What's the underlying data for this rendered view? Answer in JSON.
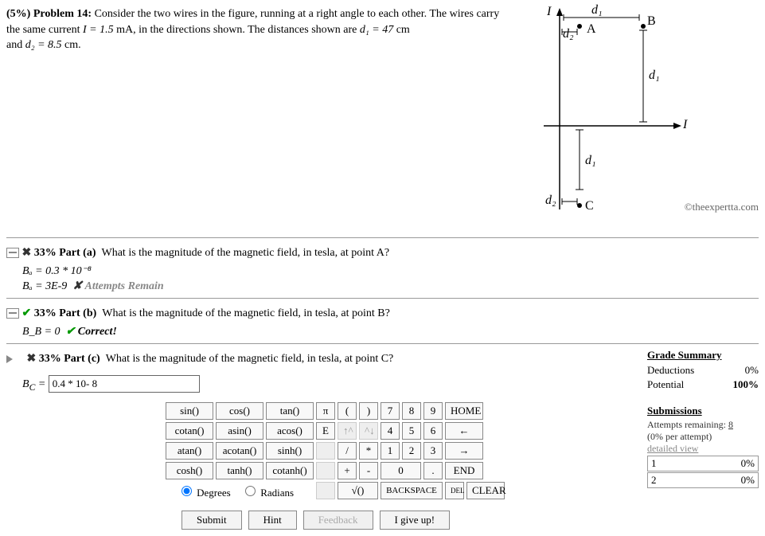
{
  "problem": {
    "label": "(5%) Problem 14:",
    "text1": "Consider the two wires in the figure, running at a right angle to each other. The wires carry the same current ",
    "ieq": "I = 1.5",
    "iunits": " mA, in the directions shown. The distances shown are ",
    "d1eq": "d₁ = 47",
    "d1units": " cm",
    "text2": "and ",
    "d2eq": "d₂ = 8.5",
    "d2units": " cm."
  },
  "figure": {
    "I": "I",
    "d1": "d₁",
    "d2": "d₂",
    "A": "A",
    "B": "B",
    "C": "C",
    "copyright": "©theexpertta.com"
  },
  "partA": {
    "pct": "33%",
    "label": "Part (a)",
    "question": "What is the magnitude of the magnetic field, in tesla, at point A?",
    "line1": "Bₐ = 0.3 * 10⁻⁸",
    "line2_prefix": "Bₐ = 3E-9",
    "line2_status": "✘ Attempts Remain"
  },
  "partB": {
    "pct": "33%",
    "label": "Part (b)",
    "question": "What is the magnitude of the magnetic field, in tesla, at point B?",
    "line1_prefix": "B_B = 0",
    "line1_status": "✔ Correct!"
  },
  "partC": {
    "pct": "33%",
    "label": "Part (c)",
    "question": "What is the magnitude of the magnetic field, in tesla, at point C?",
    "var": "B_C =",
    "value": "0.4 * 10- 8"
  },
  "keypad": {
    "r1": [
      "sin()",
      "cos()",
      "tan()"
    ],
    "r2": [
      "cotan()",
      "asin()",
      "acos()"
    ],
    "r3": [
      "atan()",
      "acotan()",
      "sinh()"
    ],
    "r4": [
      "cosh()",
      "tanh()",
      "cotanh()"
    ],
    "sym": {
      "pi": "π",
      "lp": "(",
      "rp": ")",
      "E": "E",
      "up": "↑^",
      "di": "^↓",
      "sl": "/",
      "st": "*",
      "pl": "+",
      "mn": "-",
      "sq": "√()",
      "home": "HOME",
      "bksp": "BACKSPACE",
      "del": "DEL",
      "clr": "CLEAR",
      "end": "END",
      "left": "←",
      "right": "→"
    },
    "nums": [
      "7",
      "8",
      "9",
      "4",
      "5",
      "6",
      "1",
      "2",
      "3",
      "0",
      "."
    ],
    "deg": "Degrees",
    "rad": "Radians"
  },
  "actions": {
    "submit": "Submit",
    "hint": "Hint",
    "feedback": "Feedback",
    "giveup": "I give up!"
  },
  "sidebar": {
    "gs_title": "Grade Summary",
    "ded_label": "Deductions",
    "ded_val": "0%",
    "pot_label": "Potential",
    "pot_val": "100%",
    "sub_title": "Submissions",
    "att_label": "Attempts remaining:",
    "att_val": "8",
    "per": "(0% per attempt)",
    "detailed": "detailed view",
    "rows": [
      {
        "n": "1",
        "v": "0%"
      },
      {
        "n": "2",
        "v": "0%"
      }
    ]
  }
}
